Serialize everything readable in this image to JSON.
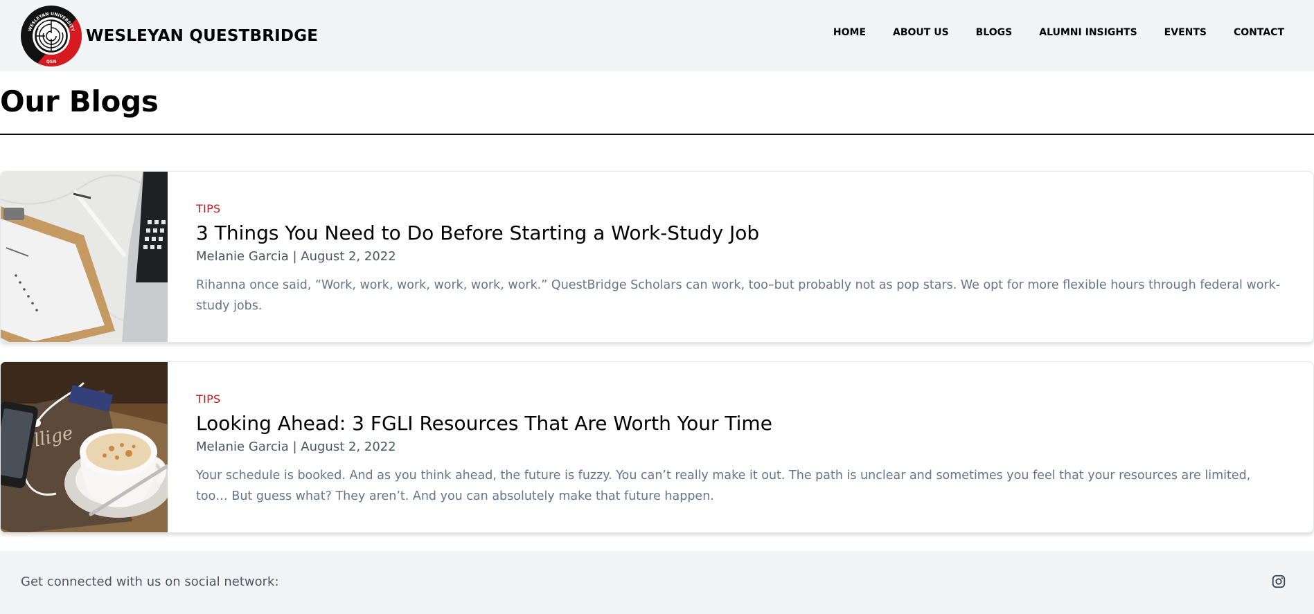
{
  "header": {
    "brand_name": "WESLEYAN QUESTBRIDGE",
    "logo": {
      "top_text": "WESLEYAN UNIVERSITY",
      "bottom_text": "QSN",
      "colors": [
        "#000000",
        "#d71920",
        "#ffffff"
      ]
    },
    "nav": [
      {
        "label": "HOME"
      },
      {
        "label": "ABOUT US"
      },
      {
        "label": "BLOGS"
      },
      {
        "label": "ALUMNI INSIGHTS"
      },
      {
        "label": "EVENTS"
      },
      {
        "label": "CONTACT"
      }
    ]
  },
  "page": {
    "title": "Our Blogs"
  },
  "posts": [
    {
      "tag": "TIPS",
      "title": "3 Things You Need to Do Before Starting a Work-Study Job",
      "meta": "Melanie Garcia | August 2, 2022",
      "excerpt": "Rihanna once said, “Work, work, work, work, work, work.” QuestBridge Scholars can work, too–but probably not as pop stars. We opt for more flexible hours through federal work-study jobs.",
      "image": "clipboard-resume-laptop-photo"
    },
    {
      "tag": "TIPS",
      "title": "Looking Ahead: 3 FGLI Resources That Are Worth Your Time",
      "meta": "Melanie Garcia | August 2, 2022",
      "excerpt": "Your schedule is booked. And as you think ahead, the future is fuzzy. You can’t really make it out. The path is unclear and sometimes you feel that your resources are limited, too… But guess what? They aren’t. And you can absolutely make that future happen.",
      "image": "coffee-cup-phone-earbuds-photo"
    }
  ],
  "footer": {
    "text": "Get connected with us on social network:",
    "social_icon": "instagram-icon"
  },
  "colors": {
    "tag": "#b91c1c",
    "header_bg": "#f3f4f6",
    "muted_text": "#64748b"
  }
}
